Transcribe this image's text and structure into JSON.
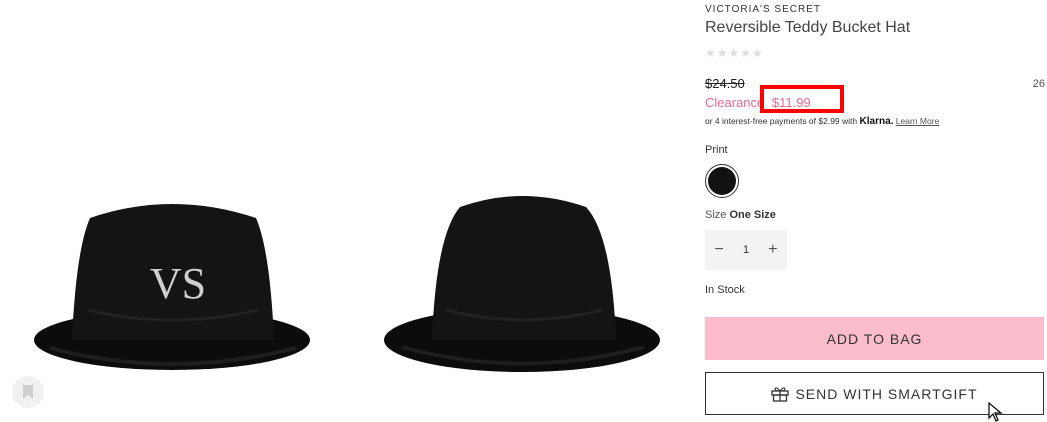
{
  "product": {
    "brand": "VICTORIA'S SECRET",
    "title": "Reversible Teddy Bucket Hat",
    "stars": "★★★★★",
    "original_price": "$24.50",
    "side_number": "26",
    "clearance_label": "Clearance",
    "clearance_price": "$11.99",
    "klarna_prefix": "or 4 interest-free payments of $2.99 with",
    "klarna_brand": "Klarna.",
    "learn_more": "Learn More"
  },
  "options": {
    "print_label": "Print",
    "size_prefix": "Size",
    "size_value": "One Size",
    "quantity": "1",
    "minus": "−",
    "plus": "+",
    "stock": "In Stock"
  },
  "actions": {
    "add_to_bag": "ADD TO BAG",
    "smartgift": "SEND WITH SMARTGIFT"
  },
  "colors": {
    "clearance": "#e86a90",
    "add_to_bag_bg": "#fbbccb",
    "highlight": "#ff0000",
    "swatch": "#111111"
  },
  "icons": [
    "bookmark-icon",
    "gift-icon",
    "mouse-cursor-icon"
  ]
}
